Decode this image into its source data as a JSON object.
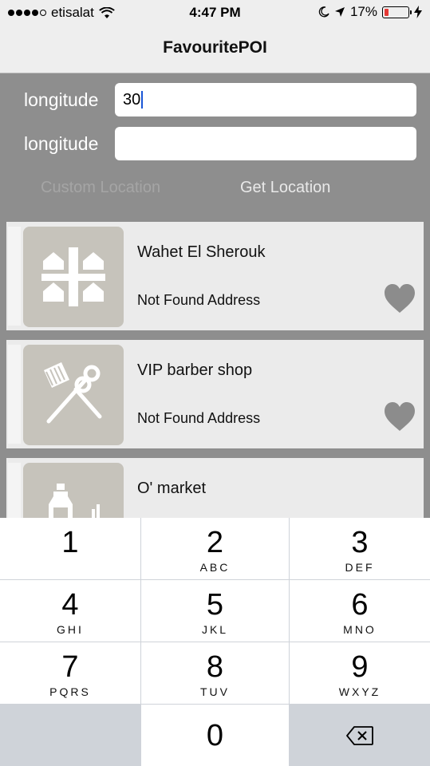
{
  "status_bar": {
    "carrier": "etisalat",
    "time": "4:47 PM",
    "battery_percent": "17%",
    "battery_level": 0.17,
    "signal_bars": 4,
    "icons": [
      "wifi-icon",
      "moon-icon",
      "location-arrow-icon",
      "battery-icon",
      "charging-bolt-icon"
    ]
  },
  "nav": {
    "title": "FavouritePOI"
  },
  "form": {
    "field1": {
      "label": "longitude",
      "value": "30"
    },
    "field2": {
      "label": "longitude",
      "value": ""
    },
    "custom_location_label": "Custom Location",
    "get_location_label": "Get Location"
  },
  "poi_list": [
    {
      "name": "Wahet El Sherouk",
      "address": "Not Found Address",
      "icon": "housing-compound-icon",
      "favourite": true
    },
    {
      "name": "VIP barber shop",
      "address": "Not Found Address",
      "icon": "barber-comb-scissors-icon",
      "favourite": true
    },
    {
      "name": "O' market",
      "address": "",
      "icon": "market-bottle-icon",
      "favourite": false
    }
  ],
  "keypad": {
    "keys": [
      {
        "num": "1",
        "letters": ""
      },
      {
        "num": "2",
        "letters": "ABC"
      },
      {
        "num": "3",
        "letters": "DEF"
      },
      {
        "num": "4",
        "letters": "GHI"
      },
      {
        "num": "5",
        "letters": "JKL"
      },
      {
        "num": "6",
        "letters": "MNO"
      },
      {
        "num": "7",
        "letters": "PQRS"
      },
      {
        "num": "8",
        "letters": "TUV"
      },
      {
        "num": "9",
        "letters": "WXYZ"
      },
      {
        "num": "0",
        "letters": ""
      }
    ],
    "delete_icon": "backspace-icon"
  },
  "colors": {
    "background": "#8e8e8e",
    "bar": "#eeeeee",
    "card": "#ebebeb",
    "thumb": "#c6c3bb",
    "heart": "#8c8c8c",
    "caret": "#1a56d6",
    "battery_low": "#e53935"
  }
}
